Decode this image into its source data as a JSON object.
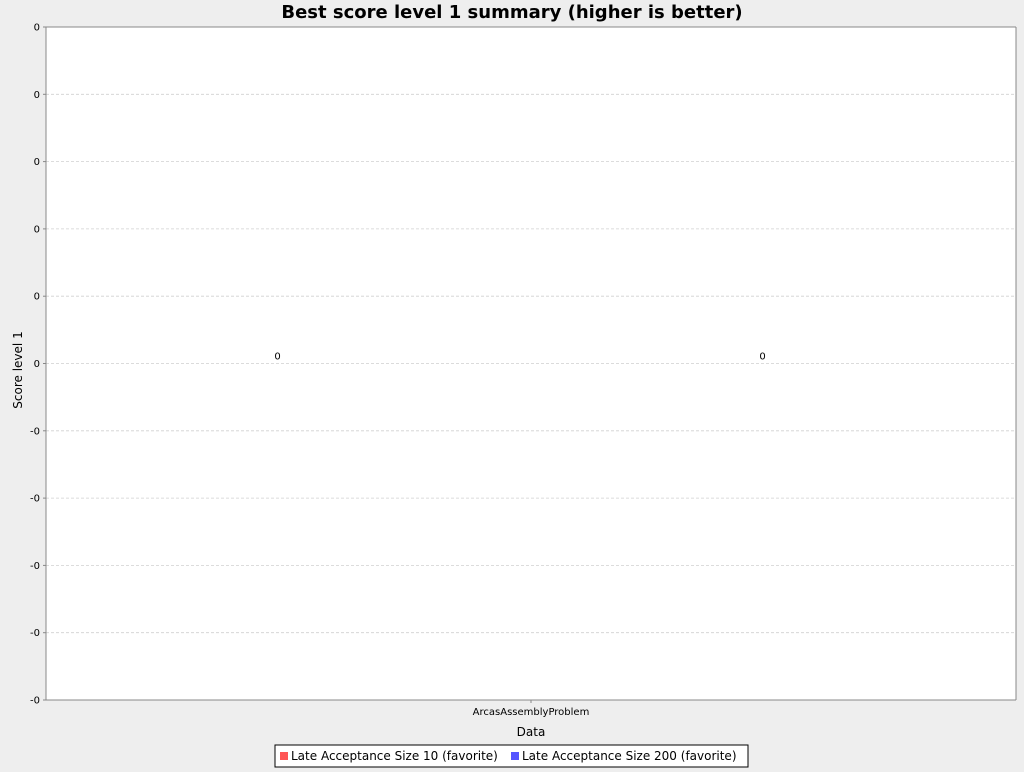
{
  "chart_data": {
    "type": "bar",
    "title": "Best score level 1 summary (higher is better)",
    "xlabel": "Data",
    "ylabel": "Score level 1",
    "categories": [
      "ArcasAssemblyProblem"
    ],
    "y_tick_labels": [
      "0",
      "0",
      "0",
      "0",
      "0",
      "0",
      "-0",
      "-0",
      "-0",
      "-0",
      "-0"
    ],
    "ylim": [
      -0.5,
      0.5
    ],
    "grid": true,
    "legend_position": "bottom",
    "series": [
      {
        "name": "Late Acceptance Size 10 (favorite)",
        "values": [
          0
        ],
        "data_labels": [
          "0"
        ],
        "color": "#ff5555"
      },
      {
        "name": "Late Acceptance Size 200 (favorite)",
        "values": [
          0
        ],
        "data_labels": [
          "0"
        ],
        "color": "#5555ff"
      }
    ]
  }
}
